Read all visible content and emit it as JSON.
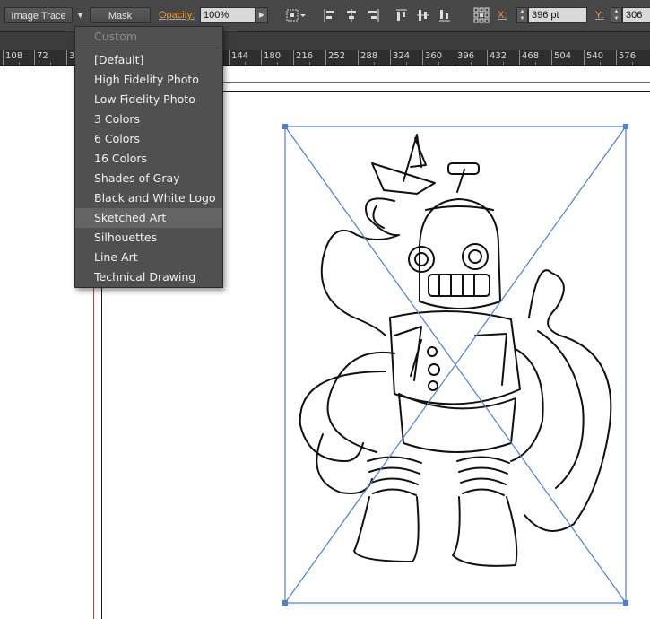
{
  "control_bar": {
    "image_trace_label": "Image Trace",
    "mask_label": "Mask",
    "opacity_label": "Opacity:",
    "opacity_value": "100%",
    "x_label": "X:",
    "x_value": "396 pt",
    "y_label": "Y:",
    "y_value": "306"
  },
  "ruler": {
    "labels": [
      "108",
      "72",
      "3",
      "144",
      "180",
      "216",
      "252",
      "288",
      "324",
      "360",
      "396",
      "432",
      "468",
      "504",
      "540",
      "576"
    ]
  },
  "preset_menu": {
    "custom_label": "Custom",
    "items": [
      "[Default]",
      "High Fidelity Photo",
      "Low Fidelity Photo",
      "3 Colors",
      "6 Colors",
      "16 Colors",
      "Shades of Gray",
      "Black and White Logo",
      "Sketched Art",
      "Silhouettes",
      "Line Art",
      "Technical Drawing"
    ],
    "highlighted": "Sketched Art"
  },
  "colors": {
    "accent_orange": "#f29b2e",
    "selection_blue": "#4a7fd9",
    "guide_red": "#d23b3b",
    "menu_bg": "#505050"
  }
}
